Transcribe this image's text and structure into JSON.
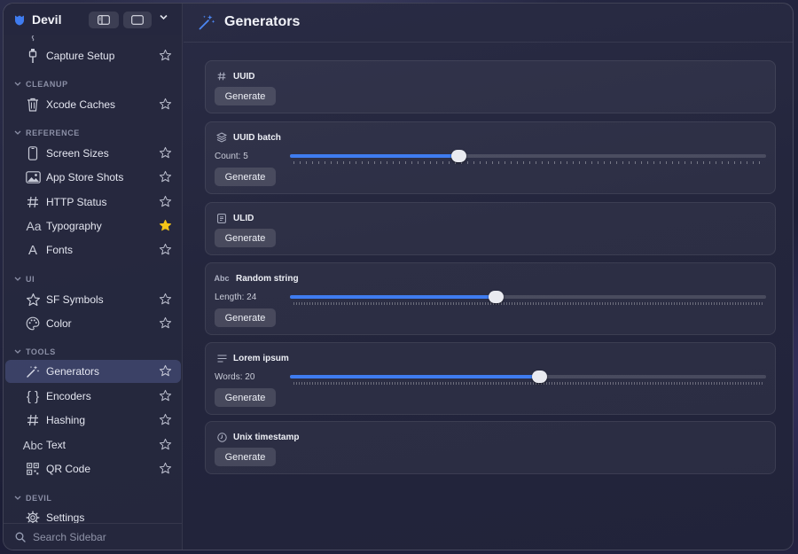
{
  "app": {
    "title": "Devil",
    "accent": "#3f7cf0"
  },
  "sidebar": {
    "sections": [
      {
        "key": "cleanup",
        "label": "CLEANUP"
      },
      {
        "key": "reference",
        "label": "REFERENCE"
      },
      {
        "key": "ui",
        "label": "UI"
      },
      {
        "key": "tools",
        "label": "TOOLS"
      },
      {
        "key": "devil",
        "label": "DEVIL"
      }
    ],
    "items": {
      "capture_setup": {
        "label": "Capture Setup",
        "icon": "cable-connector-icon",
        "favorite": false
      },
      "xcode_caches": {
        "label": "Xcode Caches",
        "icon": "trash-icon",
        "favorite": false
      },
      "screen_sizes": {
        "label": "Screen Sizes",
        "icon": "iphone-icon",
        "favorite": false
      },
      "app_store_shots": {
        "label": "App Store Shots",
        "icon": "photo-icon",
        "favorite": false
      },
      "http_status": {
        "label": "HTTP Status",
        "icon": "number-icon",
        "favorite": false
      },
      "typography": {
        "label": "Typography",
        "icon": "textformat-icon",
        "favorite": true
      },
      "fonts": {
        "label": "Fonts",
        "icon": "font-icon",
        "favorite": false
      },
      "sf_symbols": {
        "label": "SF Symbols",
        "icon": "star-outline-icon",
        "favorite": false
      },
      "color": {
        "label": "Color",
        "icon": "palette-icon",
        "favorite": false
      },
      "generators": {
        "label": "Generators",
        "icon": "wand-sparkles-icon",
        "favorite": false
      },
      "encoders": {
        "label": "Encoders",
        "icon": "curly-braces-icon",
        "favorite": false
      },
      "hashing": {
        "label": "Hashing",
        "icon": "number-icon",
        "favorite": false
      },
      "text": {
        "label": "Text",
        "icon": "textformat-abc-icon",
        "favorite": false
      },
      "qr_code": {
        "label": "QR Code",
        "icon": "qrcode-icon",
        "favorite": false
      },
      "settings": {
        "label": "Settings",
        "icon": "gear-icon",
        "favorite": false
      }
    },
    "icon_glyphs": {
      "typography": "Aa",
      "fonts": "A",
      "text": "Abc"
    },
    "search_placeholder": "Search Sidebar",
    "star_color": "#f5c518"
  },
  "main": {
    "title": "Generators",
    "title_icon": "wand-sparkles-icon",
    "cards": {
      "uuid": {
        "title": "UUID",
        "icon": "number-icon",
        "button": "Generate"
      },
      "uuid_batch": {
        "title": "UUID batch",
        "icon": "layers-icon",
        "button": "Generate",
        "slider_label": "Count: 5",
        "value": 5,
        "range": [
          1,
          100
        ]
      },
      "ulid": {
        "title": "ULID",
        "icon": "doc-text-icon",
        "button": "Generate"
      },
      "random_string": {
        "title": "Random string",
        "icon": "textformat-abc-icon",
        "icon_glyph": "Abc",
        "button": "Generate",
        "slider_label": "Length: 24",
        "value": 24,
        "range": [
          4,
          256
        ]
      },
      "lorem_ipsum": {
        "title": "Lorem ipsum",
        "icon": "text-lines-icon",
        "button": "Generate",
        "slider_label": "Words: 20",
        "value": 20,
        "range": [
          1,
          300
        ]
      },
      "unix_timestamp": {
        "title": "Unix timestamp",
        "icon": "clock-icon",
        "button": "Generate"
      }
    }
  }
}
